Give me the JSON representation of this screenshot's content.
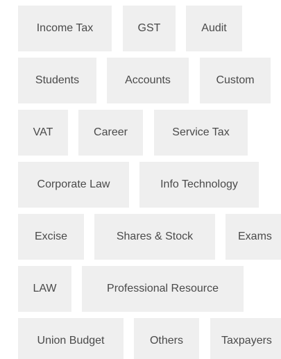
{
  "tags": [
    "Income Tax",
    "GST",
    "Audit",
    "Students",
    "Accounts",
    "Custom",
    "VAT",
    "Career",
    "Service Tax",
    "Corporate Law",
    "Info Technology",
    "Excise",
    "Shares & Stock",
    "Exams",
    "LAW",
    "Professional Resource",
    "Union Budget",
    "Others",
    "Taxpayers"
  ]
}
